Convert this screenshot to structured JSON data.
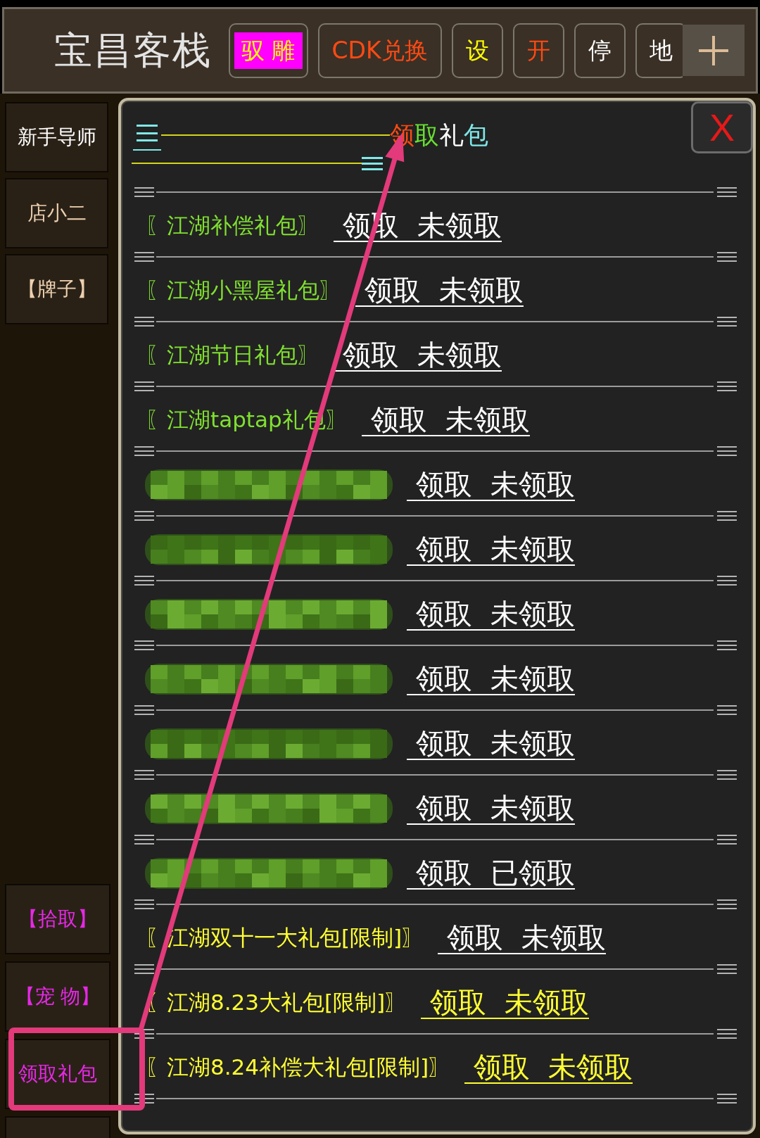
{
  "header": {
    "title": "宝昌客栈",
    "buttons": [
      {
        "label": "驭 雕",
        "color": "#ffff00",
        "highlighted": true
      },
      {
        "label": "CDK兑换",
        "color": "#ff4a12",
        "highlighted": false
      },
      {
        "label": "设",
        "color": "#ffff00",
        "highlighted": false
      },
      {
        "label": "开",
        "color": "#ff4a12",
        "highlighted": false
      },
      {
        "label": "停",
        "color": "#ffffff",
        "highlighted": false
      },
      {
        "label": "地",
        "color": "#ffffff",
        "highlighted": false
      }
    ]
  },
  "sidebar": {
    "top_items": [
      {
        "label": "新手导师",
        "color": "#ffffff"
      },
      {
        "label": "店小二",
        "color": "#ecd0b0"
      },
      {
        "label": "【牌子】",
        "color": "#ecd0b0"
      }
    ],
    "bottom_items": [
      {
        "kind": "text",
        "label": "【拾取】"
      },
      {
        "kind": "text",
        "label": "【宠 物】"
      },
      {
        "kind": "text",
        "label": "领取礼包"
      },
      {
        "kind": "empty"
      }
    ]
  },
  "panel": {
    "title": "领取礼包",
    "close": "X",
    "rows": [
      {
        "redacted": false,
        "name": "〖江湖补偿礼包〗",
        "color": "#80e030",
        "action": "领取",
        "status": "未领取",
        "highlighted": false
      },
      {
        "redacted": false,
        "name": "〖江湖小黑屋礼包〗",
        "color": "#80e030",
        "action": "领取",
        "status": "未领取",
        "highlighted": false
      },
      {
        "redacted": false,
        "name": "〖江湖节日礼包〗",
        "color": "#80e030",
        "action": "领取",
        "status": "未领取",
        "highlighted": false
      },
      {
        "redacted": false,
        "name": "〖江湖taptap礼包〗",
        "color": "#80e030",
        "action": "领取",
        "status": "未领取",
        "highlighted": false
      },
      {
        "redacted": true,
        "action": "领取",
        "status": "未领取",
        "highlighted": false
      },
      {
        "redacted": true,
        "action": "领取",
        "status": "未领取",
        "highlighted": false
      },
      {
        "redacted": true,
        "action": "领取",
        "status": "未领取",
        "highlighted": false
      },
      {
        "redacted": true,
        "action": "领取",
        "status": "未领取",
        "highlighted": false
      },
      {
        "redacted": true,
        "action": "领取",
        "status": "未领取",
        "highlighted": false
      },
      {
        "redacted": true,
        "action": "领取",
        "status": "未领取",
        "highlighted": false
      },
      {
        "redacted": true,
        "action": "领取",
        "status": "已领取",
        "highlighted": false
      },
      {
        "redacted": false,
        "name": "〖江湖双十一大礼包[限制]〗",
        "color": "#ffff33",
        "action": "领取",
        "status": "未领取",
        "highlighted": false
      },
      {
        "redacted": false,
        "name": "〖江湖8.23大礼包[限制]〗",
        "color": "#ffff33",
        "action": "领取",
        "status": "未领取",
        "highlighted": true
      },
      {
        "redacted": false,
        "name": "〖江湖8.24补偿大礼包[限制]〗",
        "color": "#ffff33",
        "action": "领取",
        "status": "未领取",
        "highlighted": true
      }
    ]
  },
  "annotations": [
    {
      "kind": "arrow"
    },
    {
      "kind": "frame"
    }
  ]
}
